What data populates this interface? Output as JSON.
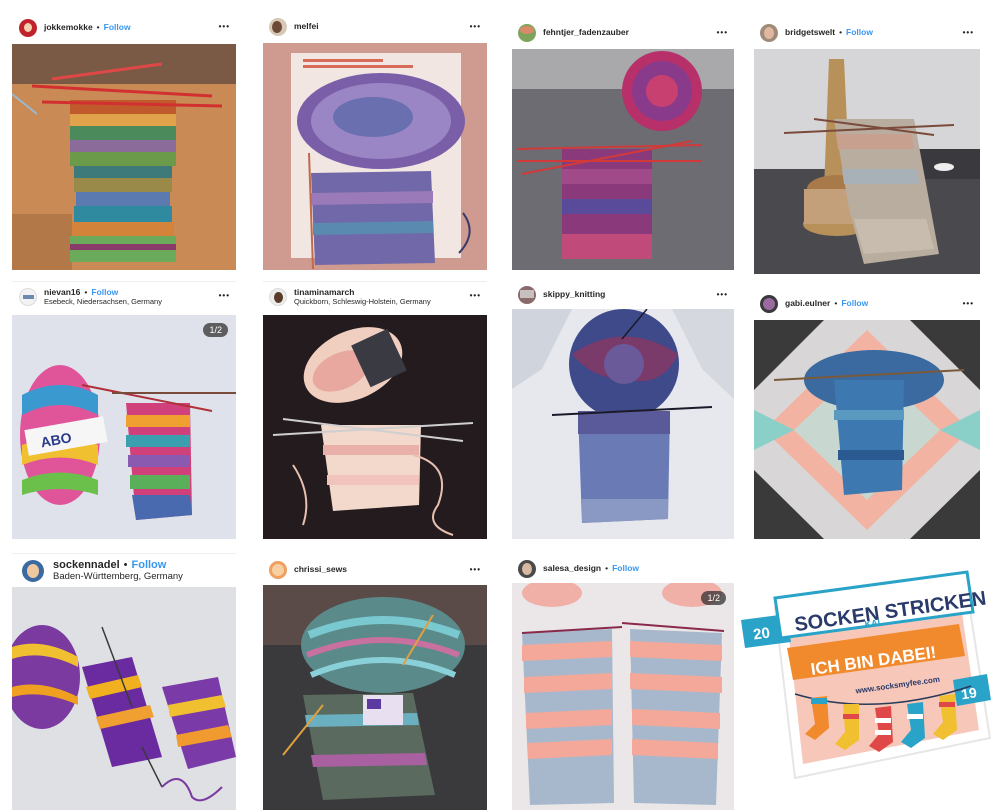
{
  "posts": [
    {
      "user": "jokkemokke",
      "follow": "Follow",
      "location": "",
      "counter": "",
      "more": "•••"
    },
    {
      "user": "melfei",
      "follow": "",
      "location": "",
      "counter": "",
      "more": "•••"
    },
    {
      "user": "fehntjer_fadenzauber",
      "follow": "",
      "location": "",
      "counter": "",
      "more": "•••"
    },
    {
      "user": "bridgetswelt",
      "follow": "Follow",
      "location": "",
      "counter": "",
      "more": "•••"
    },
    {
      "user": "nievan16",
      "follow": "Follow",
      "location": "Esebeck, Niedersachsen, Germany",
      "counter": "1/2",
      "more": "•••"
    },
    {
      "user": "tinaminamarch",
      "follow": "",
      "location": "Quickborn, Schleswig-Holstein, Germany",
      "counter": "",
      "more": "•••"
    },
    {
      "user": "skippy_knitting",
      "follow": "",
      "location": "",
      "counter": "",
      "more": "•••"
    },
    {
      "user": "gabi.eulner",
      "follow": "Follow",
      "location": "",
      "counter": "",
      "more": "•••"
    },
    {
      "user": "sockennadel",
      "follow": "Follow",
      "location": "Baden-Württemberg, Germany",
      "counter": "",
      "more": ""
    },
    {
      "user": "chrissi_sews",
      "follow": "",
      "location": "",
      "counter": "",
      "more": "•••"
    },
    {
      "user": "salesa_design",
      "follow": "Follow",
      "location": "",
      "counter": "1/2",
      "more": ""
    }
  ],
  "sticker": {
    "title": "SOCKEN STRICKEN",
    "subtitle": "ICH BIN DABEI!",
    "url": "www.socksmyfee.com",
    "kal": "KAL",
    "year_left": "20",
    "year_right": "19"
  },
  "colors": {
    "follow": "#3897f0",
    "sticker_banner": "#2aa3c9",
    "sticker_orange": "#f08a2c",
    "sticker_pink": "#f7c8b9"
  }
}
